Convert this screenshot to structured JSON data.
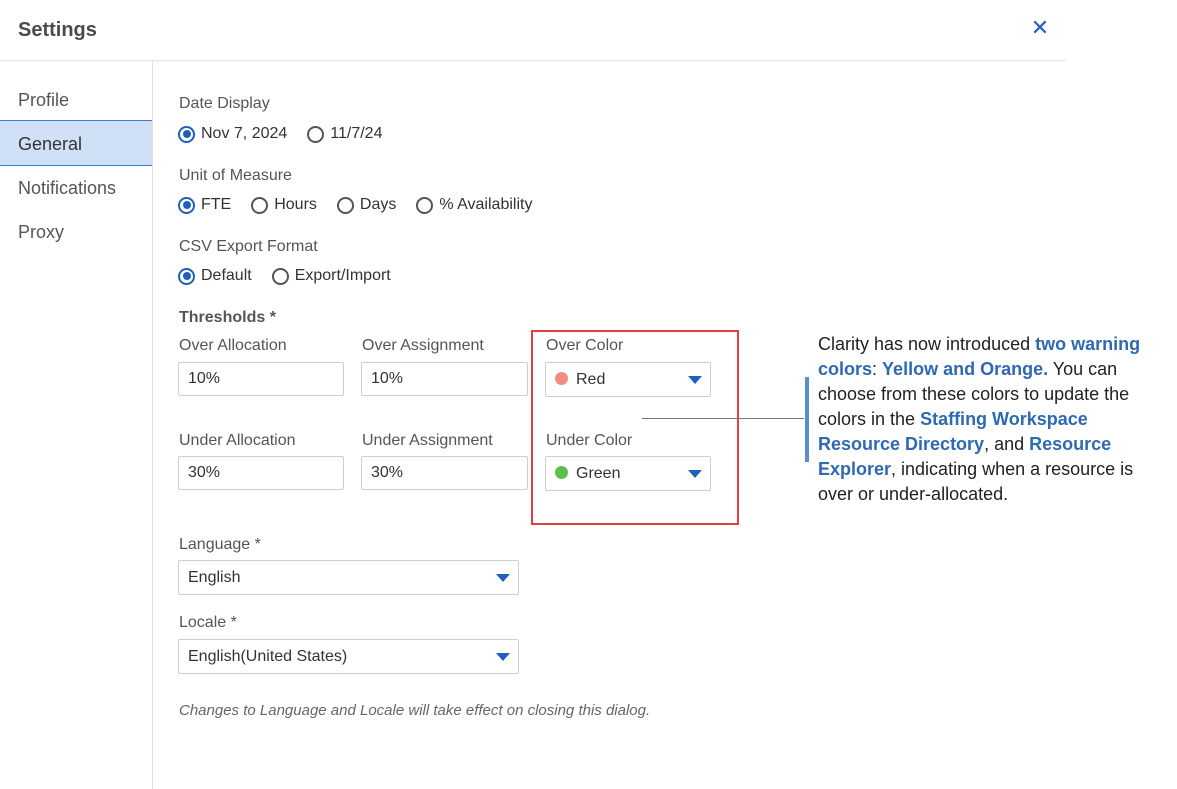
{
  "dialog": {
    "title": "Settings",
    "close_icon": "close-icon"
  },
  "sidebar": {
    "items": [
      {
        "label": "Profile"
      },
      {
        "label": "General"
      },
      {
        "label": "Notifications"
      },
      {
        "label": "Proxy"
      }
    ],
    "active": "General"
  },
  "general": {
    "date_display": {
      "label": "Date Display",
      "options": [
        "Nov 7, 2024",
        "11/7/24"
      ],
      "selected": "Nov 7, 2024"
    },
    "unit_of_measure": {
      "label": "Unit of Measure",
      "options": [
        "FTE",
        "Hours",
        "Days",
        "% Availability"
      ],
      "selected": "FTE"
    },
    "csv_export": {
      "label": "CSV Export Format",
      "options": [
        "Default",
        "Export/Import"
      ],
      "selected": "Default"
    },
    "thresholds": {
      "label": "Thresholds",
      "over_allocation": {
        "label": "Over Allocation",
        "value": "10%"
      },
      "over_assignment": {
        "label": "Over Assignment",
        "value": "10%"
      },
      "over_color": {
        "label": "Over Color",
        "value": "Red",
        "swatch": "#f28b82"
      },
      "under_allocation": {
        "label": "Under Allocation",
        "value": "30%"
      },
      "under_assignment": {
        "label": "Under Assignment",
        "value": "30%"
      },
      "under_color": {
        "label": "Under Color",
        "value": "Green",
        "swatch": "#5cc04c"
      }
    },
    "required_marker": "*",
    "language": {
      "label": "Language",
      "value": "English"
    },
    "locale": {
      "label": "Locale",
      "value": "English(United States)"
    },
    "note": "Changes to Language and Locale will take effect on closing this dialog."
  },
  "callout": {
    "t1": "Clarity has now introduced ",
    "h1": "two warning colors",
    "t2": ": ",
    "h2": "Yellow and Orange.",
    "t3": " You can choose from these colors to update the colors in the ",
    "h3": "Staffing Workspace Resource Directory",
    "t4": ", and ",
    "h4": "Resource Explorer",
    "t5": ", indicating when a resource is over or under-allocated."
  },
  "colors": {
    "accent": "#1f5fbf",
    "highlight_box": "#e04040",
    "callout_text": "#2e69b3"
  }
}
